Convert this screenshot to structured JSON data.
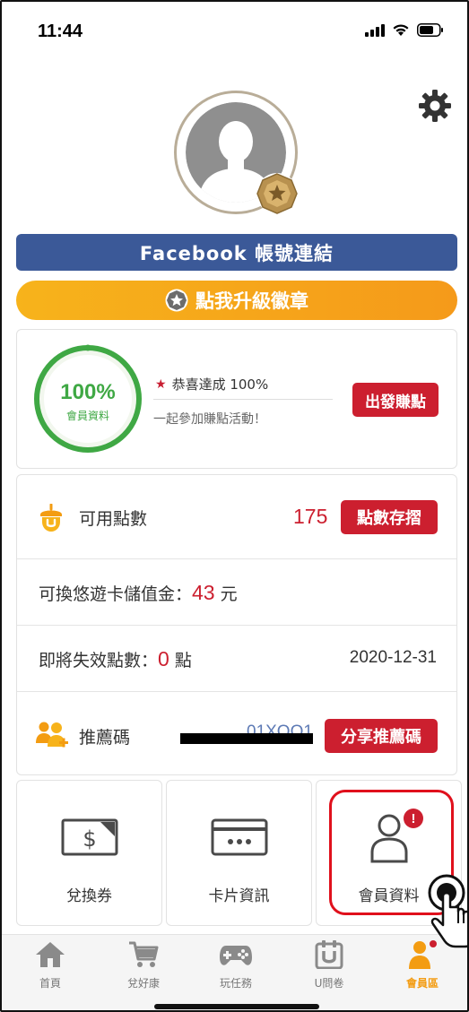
{
  "status_bar": {
    "time": "11:44"
  },
  "profile": {
    "facebook_button": "Facebook 帳號連結",
    "upgrade_button": "點我升級徽章"
  },
  "completion": {
    "percent_text": "100%",
    "percent_value": 100,
    "label": "會員資料",
    "congrats": "恭喜達成 100%",
    "subtitle": "一起參加賺點活動！",
    "earn_button": "出發賺點"
  },
  "points": {
    "available_label": "可用點數",
    "available_value": "175",
    "deposit_button": "點數存摺",
    "exchange_prefix": "可換悠遊卡儲值金：",
    "exchange_value": "43",
    "exchange_suffix": " 元",
    "expire_prefix": "即將失效點數：",
    "expire_value": "0",
    "expire_suffix": " 點",
    "expire_date": "2020-12-31",
    "referral_label": "推薦碼",
    "referral_code": "01XQQ1",
    "share_button": "分享推薦碼"
  },
  "tiles": [
    {
      "label": "兌換券",
      "icon": "voucher-icon"
    },
    {
      "label": "卡片資訊",
      "icon": "card-icon"
    },
    {
      "label": "會員資料",
      "icon": "member-icon",
      "alert": "!"
    }
  ],
  "tab_bar": [
    {
      "label": "首頁",
      "icon": "home-icon"
    },
    {
      "label": "兌好康",
      "icon": "cart-icon"
    },
    {
      "label": "玩任務",
      "icon": "gamepad-icon"
    },
    {
      "label": "U問卷",
      "icon": "survey-icon"
    },
    {
      "label": "會員區",
      "icon": "member-area-icon",
      "active": true
    }
  ],
  "colors": {
    "facebook": "#3b5998",
    "accent_red": "#cc1f2f",
    "upgrade_orange": "#f7b31b",
    "progress_green": "#3fa844",
    "active_tab": "#f39c12"
  }
}
